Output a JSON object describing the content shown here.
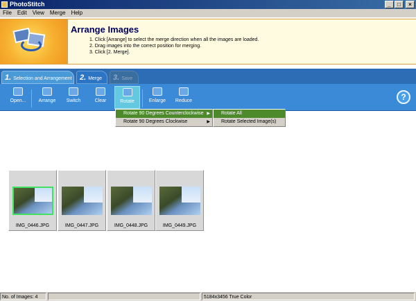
{
  "window": {
    "title": "PhotoStitch"
  },
  "menubar": [
    "File",
    "Edit",
    "View",
    "Merge",
    "Help"
  ],
  "banner": {
    "title": "Arrange Images",
    "steps": [
      "1. Click [Arrange] to select the merge direction when all the images are loaded.",
      "2. Drag images into the correct position for merging.",
      "3. Click [2. Merge]."
    ]
  },
  "tabs": [
    {
      "num": "1.",
      "label": "Selection and Arrangement"
    },
    {
      "num": "2.",
      "label": "Merge"
    },
    {
      "num": "3.",
      "label": "Save"
    }
  ],
  "toolbar": {
    "open": "Open...",
    "arrange": "Arrange",
    "switch": "Switch",
    "clear": "Clear",
    "rotate": "Rotate",
    "enlarge": "Enlarge",
    "reduce": "Reduce",
    "help": "?"
  },
  "rotate_menu": {
    "items": [
      "Rotate 90 Degrees Counterclockwise",
      "Rotate 90 Degrees Clockwise"
    ],
    "submenu": [
      "Rotate All",
      "Rotate Selected Image(s)"
    ]
  },
  "images": [
    "IMG_0446.JPG",
    "IMG_0447.JPG",
    "IMG_0448.JPG",
    "IMG_0449.JPG"
  ],
  "status": {
    "count": "No. of Images: 4",
    "info": "5184x3456 True Color"
  }
}
